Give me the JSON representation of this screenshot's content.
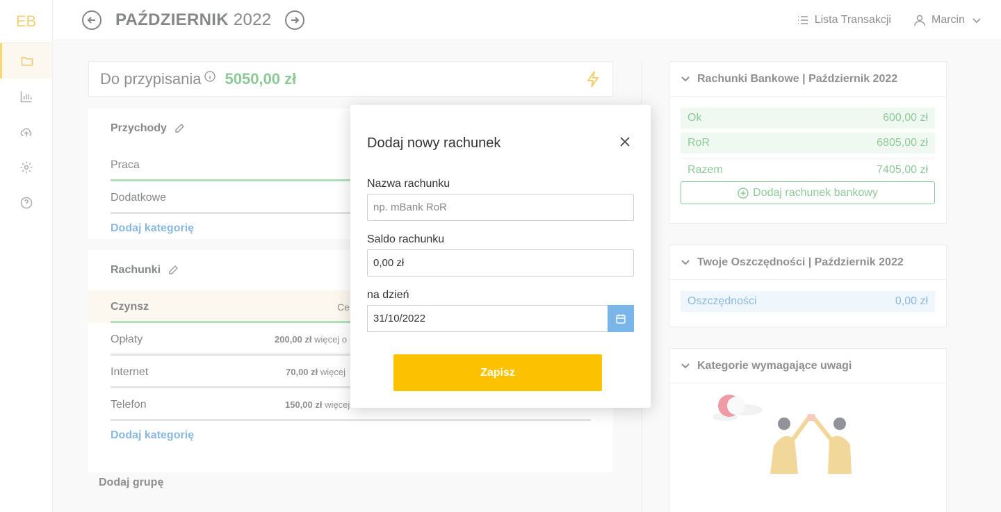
{
  "sidebar": {
    "logo": "EB",
    "items": [
      {
        "icon": "folder-icon"
      },
      {
        "icon": "chart-icon"
      },
      {
        "icon": "cloud-upload-icon"
      },
      {
        "icon": "gear-icon"
      },
      {
        "icon": "help-icon"
      }
    ]
  },
  "topbar": {
    "month_bold": "PAŹDZIERNIK",
    "year": "2022",
    "transactions_label": "Lista Transakcji",
    "user_name": "Marcin"
  },
  "assign": {
    "label": "Do przypisania",
    "amount": "5050,00 zł"
  },
  "groups": [
    {
      "title": "Przychody",
      "categories": [
        {
          "name": "Praca"
        },
        {
          "name": "Dodatkowe"
        }
      ],
      "add_label": "Dodaj kategorię"
    },
    {
      "title": "Rachunki",
      "categories": [
        {
          "name": "Czynsz",
          "info": "Ce"
        },
        {
          "name": "Opłaty",
          "info_amount": "200,00 zł",
          "info_text": "więcej o"
        },
        {
          "name": "Internet",
          "info_amount": "70,00 zł",
          "info_text": "więcej"
        },
        {
          "name": "Telefon",
          "info_amount": "150,00 zł",
          "info_text": "więcej"
        }
      ],
      "add_label": "Dodaj kategorię"
    }
  ],
  "add_group_label": "Dodaj grupę",
  "bank_accounts": {
    "title": "Rachunki Bankowe | Październik 2022",
    "accounts": [
      {
        "name": "Ok",
        "amount": "600,00 zł"
      },
      {
        "name": "RoR",
        "amount": "6805,00 zł"
      }
    ],
    "total_label": "Razem",
    "total_amount": "7405,00 zł",
    "add_label": "Dodaj rachunek bankowy"
  },
  "savings": {
    "title": "Twoje Oszczędności | Październik 2022",
    "row_label": "Oszczędności",
    "row_amount": "0,00 zł"
  },
  "attention": {
    "title": "Kategorie wymagające uwagi"
  },
  "modal": {
    "title": "Dodaj nowy rachunek",
    "name_label": "Nazwa rachunku",
    "name_placeholder": "np. mBank RoR",
    "balance_label": "Saldo rachunku",
    "balance_value": "0,00 zł",
    "date_label": "na dzień",
    "date_value": "31/10/2022",
    "save_label": "Zapisz"
  },
  "colors": {
    "accent": "#fcc201",
    "positive": "#2f9e3f",
    "link": "#2a7fc9"
  }
}
